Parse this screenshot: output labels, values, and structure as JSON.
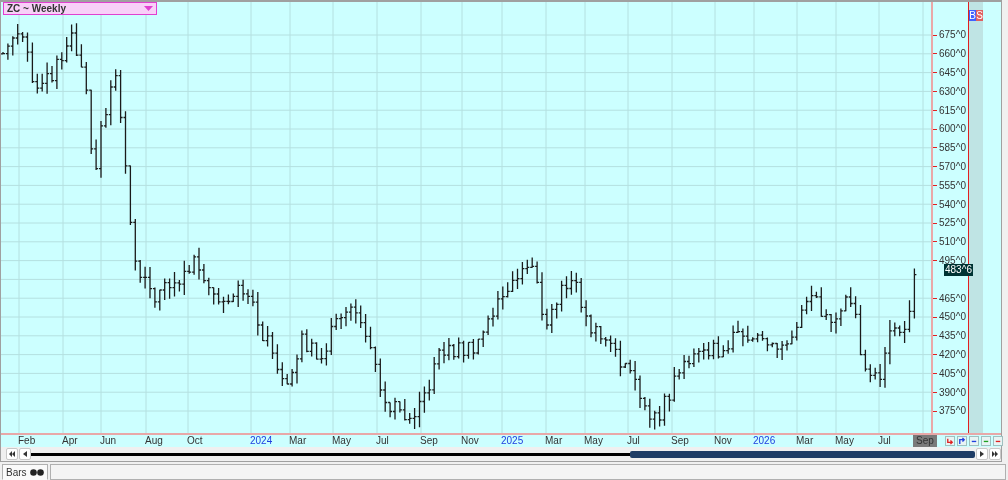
{
  "chart": {
    "symbol_menu": {
      "label": "ZC ~ Weekly"
    },
    "side_buttons": [
      {
        "label": "B",
        "kind": "buy"
      },
      {
        "label": "S",
        "kind": "sell"
      }
    ],
    "price_axis": [
      {
        "label": "675^0",
        "kind": "tick"
      },
      {
        "label": "660^0",
        "kind": "tick"
      },
      {
        "label": "645^0",
        "kind": "tick"
      },
      {
        "label": "630^0",
        "kind": "tick"
      },
      {
        "label": "615^0",
        "kind": "tick"
      },
      {
        "label": "600^0",
        "kind": "tick"
      },
      {
        "label": "585^0",
        "kind": "tick"
      },
      {
        "label": "570^0",
        "kind": "tick"
      },
      {
        "label": "555^0",
        "kind": "tick"
      },
      {
        "label": "540^0",
        "kind": "tick"
      },
      {
        "label": "525^0",
        "kind": "tick"
      },
      {
        "label": "510^0",
        "kind": "tick"
      },
      {
        "label": "495^0",
        "kind": "tick"
      },
      {
        "label": "483^6",
        "kind": "last"
      },
      {
        "label": "465^0",
        "kind": "tick"
      },
      {
        "label": "450^0",
        "kind": "tick"
      },
      {
        "label": "435^0",
        "kind": "tick"
      },
      {
        "label": "420^0",
        "kind": "tick"
      },
      {
        "label": "405^0",
        "kind": "tick"
      },
      {
        "label": "390^0",
        "kind": "tick"
      },
      {
        "label": "375^0",
        "kind": "tick"
      }
    ],
    "time_axis": [
      {
        "label": "Feb",
        "kind": "month"
      },
      {
        "label": "Apr",
        "kind": "month"
      },
      {
        "label": "Jun",
        "kind": "month"
      },
      {
        "label": "Aug",
        "kind": "month"
      },
      {
        "label": "Oct",
        "kind": "month"
      },
      {
        "label": "2024",
        "kind": "year"
      },
      {
        "label": "Mar",
        "kind": "month"
      },
      {
        "label": "May",
        "kind": "month"
      },
      {
        "label": "Jul",
        "kind": "month"
      },
      {
        "label": "Sep",
        "kind": "month"
      },
      {
        "label": "Nov",
        "kind": "month"
      },
      {
        "label": "2025",
        "kind": "year"
      },
      {
        "label": "Mar",
        "kind": "month"
      },
      {
        "label": "May",
        "kind": "month"
      },
      {
        "label": "Jul",
        "kind": "month"
      },
      {
        "label": "Sep",
        "kind": "month"
      },
      {
        "label": "Nov",
        "kind": "month"
      },
      {
        "label": "2026",
        "kind": "year"
      },
      {
        "label": "Mar",
        "kind": "month"
      },
      {
        "label": "May",
        "kind": "month"
      },
      {
        "label": "Jul",
        "kind": "month"
      },
      {
        "label": "Sep",
        "kind": "current"
      }
    ]
  },
  "tabs": [
    {
      "label": "Bars",
      "selected": true
    }
  ]
}
